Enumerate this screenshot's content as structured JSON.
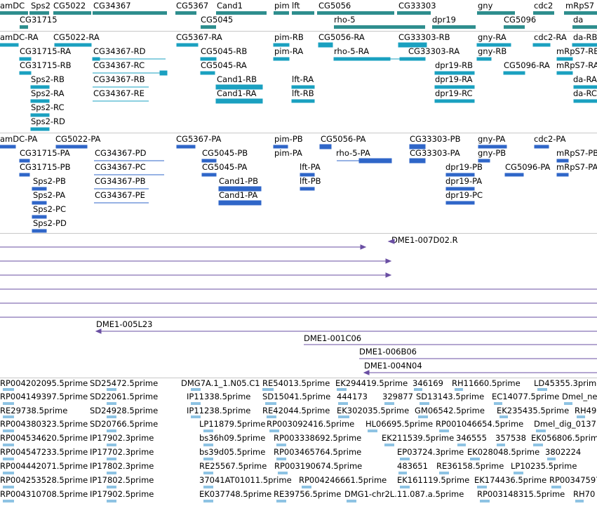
{
  "colors": {
    "gene": "#2e8e8e",
    "transcript": "#1aa0c0",
    "protein": "#2f66c8",
    "clone": "#6a4fa3",
    "est": "#8ec3e3",
    "separator": "#c8c8c8"
  },
  "genes": [
    {
      "label": "amDC"
    },
    {
      "label": "Sps2"
    },
    {
      "label": "CG5022"
    },
    {
      "label": "CG34367"
    },
    {
      "label": "CG5367"
    },
    {
      "label": "Cand1"
    },
    {
      "label": "pim"
    },
    {
      "label": "lft"
    },
    {
      "label": "CG5056"
    },
    {
      "label": "CG33303"
    },
    {
      "label": "gny"
    },
    {
      "label": "cdc2"
    },
    {
      "label": "mRpS7"
    },
    {
      "label": "CG31715"
    },
    {
      "label": "CG5045"
    },
    {
      "label": "rho-5"
    },
    {
      "label": "dpr19"
    },
    {
      "label": "CG5096"
    },
    {
      "label": "da"
    }
  ],
  "transcripts": [
    {
      "label": "amDC-RA"
    },
    {
      "label": "CG5022-RA"
    },
    {
      "label": "CG5367-RA"
    },
    {
      "label": "pim-RB"
    },
    {
      "label": "CG5056-RA"
    },
    {
      "label": "CG33303-RB"
    },
    {
      "label": "gny-RA"
    },
    {
      "label": "cdc2-RA"
    },
    {
      "label": "da-RB"
    },
    {
      "label": "CG31715-RA"
    },
    {
      "label": "CG34367-RD"
    },
    {
      "label": "CG5045-RB"
    },
    {
      "label": "pim-RA"
    },
    {
      "label": "rho-5-RA"
    },
    {
      "label": "CG33303-RA"
    },
    {
      "label": "gny-RB"
    },
    {
      "label": "mRpS7-RB"
    },
    {
      "label": "CG31715-RB"
    },
    {
      "label": "CG34367-RC"
    },
    {
      "label": "CG5045-RA"
    },
    {
      "label": "dpr19-RB"
    },
    {
      "label": "CG5096-RA"
    },
    {
      "label": "mRpS7-RA"
    },
    {
      "label": "Sps2-RB"
    },
    {
      "label": "CG34367-RB"
    },
    {
      "label": "Cand1-RB"
    },
    {
      "label": "lft-RA"
    },
    {
      "label": "dpr19-RA"
    },
    {
      "label": "da-RA"
    },
    {
      "label": "Sps2-RA"
    },
    {
      "label": "CG34367-RE"
    },
    {
      "label": "Cand1-RA"
    },
    {
      "label": "lft-RB"
    },
    {
      "label": "dpr19-RC"
    },
    {
      "label": "da-RC"
    },
    {
      "label": "Sps2-RC"
    },
    {
      "label": "Sps2-RD"
    }
  ],
  "proteins": [
    {
      "label": "amDC-PA"
    },
    {
      "label": "CG5022-PA"
    },
    {
      "label": "CG5367-PA"
    },
    {
      "label": "pim-PB"
    },
    {
      "label": "CG5056-PA"
    },
    {
      "label": "CG33303-PB"
    },
    {
      "label": "gny-PA"
    },
    {
      "label": "cdc2-PA"
    },
    {
      "label": "CG31715-PA"
    },
    {
      "label": "CG34367-PD"
    },
    {
      "label": "CG5045-PB"
    },
    {
      "label": "pim-PA"
    },
    {
      "label": "rho-5-PA"
    },
    {
      "label": "CG33303-PA"
    },
    {
      "label": "gny-PB"
    },
    {
      "label": "mRpS7-PB"
    },
    {
      "label": "CG31715-PB"
    },
    {
      "label": "CG34367-PC"
    },
    {
      "label": "CG5045-PA"
    },
    {
      "label": "lft-PA"
    },
    {
      "label": "dpr19-PB"
    },
    {
      "label": "CG5096-PA"
    },
    {
      "label": "mRpS7-PA"
    },
    {
      "label": "Sps2-PB"
    },
    {
      "label": "CG34367-PB"
    },
    {
      "label": "Cand1-PB"
    },
    {
      "label": "lft-PB"
    },
    {
      "label": "dpr19-PA"
    },
    {
      "label": "Sps2-PA"
    },
    {
      "label": "CG34367-PE"
    },
    {
      "label": "Cand1-PA"
    },
    {
      "label": "dpr19-PC"
    },
    {
      "label": "Sps2-PC"
    },
    {
      "label": "Sps2-PD"
    }
  ],
  "clones": [
    {
      "label": "DME1-007D02.R"
    },
    {
      "label": "DME1-005L23"
    },
    {
      "label": "DME1-001C06"
    },
    {
      "label": "DME1-006B06"
    },
    {
      "label": "DME1-004N04"
    }
  ],
  "ests": [
    {
      "label": "RP004202095.5prime"
    },
    {
      "label": "SD25472.5prime"
    },
    {
      "label": "DMG7A.1_1.N05.C1"
    },
    {
      "label": "RE54013.5prime"
    },
    {
      "label": "EK294419.5prime"
    },
    {
      "label": "346169"
    },
    {
      "label": "RH11660.5prime"
    },
    {
      "label": "LD45355.3prime"
    },
    {
      "label": "RP004149397.5prime"
    },
    {
      "label": "SD22061.5prime"
    },
    {
      "label": "IP11338.5prime"
    },
    {
      "label": "SD15041.5prime"
    },
    {
      "label": "444173"
    },
    {
      "label": "329877"
    },
    {
      "label": "SD13143.5prime"
    },
    {
      "label": "EC14077.5prime"
    },
    {
      "label": "Dmel_ne"
    },
    {
      "label": "RE29738.5prime"
    },
    {
      "label": "SD24928.5prime"
    },
    {
      "label": "IP11238.5prime"
    },
    {
      "label": "RE42044.5prime"
    },
    {
      "label": "EK302035.5prime"
    },
    {
      "label": "GM06542.5prime"
    },
    {
      "label": "EK235435.5prime"
    },
    {
      "label": "RH49"
    },
    {
      "label": "RP004380323.5prime"
    },
    {
      "label": "SD20766.5prime"
    },
    {
      "label": "LP11879.5prime"
    },
    {
      "label": "RP003092416.5prime"
    },
    {
      "label": "HL06695.5prime"
    },
    {
      "label": "RP001046654.5prime"
    },
    {
      "label": "Dmel_dig_0137"
    },
    {
      "label": "RP004534620.5prime"
    },
    {
      "label": "IP17902.3prime"
    },
    {
      "label": "bs36h09.5prime"
    },
    {
      "label": "RP003338692.5prime"
    },
    {
      "label": "EK211539.5prime"
    },
    {
      "label": "346555"
    },
    {
      "label": "357538"
    },
    {
      "label": "EK056806.5prime"
    },
    {
      "label": "RP004547233.5prime"
    },
    {
      "label": "IP17702.3prime"
    },
    {
      "label": "bs39d05.5prime"
    },
    {
      "label": "RP003465764.5prime"
    },
    {
      "label": "EP03724.3prime"
    },
    {
      "label": "EK028048.5prime"
    },
    {
      "label": "3802224"
    },
    {
      "label": "RP004442071.5prime"
    },
    {
      "label": "IP17802.3prime"
    },
    {
      "label": "RE25567.5prime"
    },
    {
      "label": "RP003190674.5prime"
    },
    {
      "label": "483651"
    },
    {
      "label": "RE36158.5prime"
    },
    {
      "label": "LP10235.5prime"
    },
    {
      "label": "RP004253528.5prime"
    },
    {
      "label": "IP17802.5prime"
    },
    {
      "label": "37041AT01011.5prime"
    },
    {
      "label": "RP004246661.5prime"
    },
    {
      "label": "EK161119.5prime"
    },
    {
      "label": "EK174436.5prime"
    },
    {
      "label": "RP00347597"
    },
    {
      "label": "RP004310708.5prime"
    },
    {
      "label": "IP17902.5prime"
    },
    {
      "label": "EK037748.5prime"
    },
    {
      "label": "RE39756.5prime"
    },
    {
      "label": "DMG1-chr2L.11.087.a.5prime"
    },
    {
      "label": "RP003148315.5prime"
    },
    {
      "label": "RH70"
    }
  ]
}
